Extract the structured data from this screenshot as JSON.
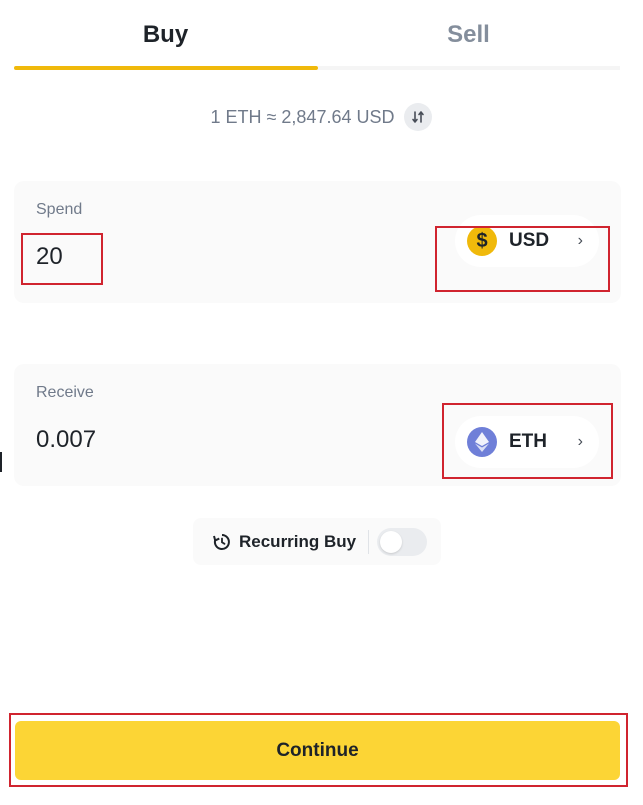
{
  "tabs": {
    "buy": "Buy",
    "sell": "Sell",
    "active": "Buy"
  },
  "rate": {
    "text": "1 ETH ≈ 2,847.64 USD"
  },
  "spend": {
    "label": "Spend",
    "amount": "20",
    "asset": "USD",
    "asset_icon": "dollar-coin-icon"
  },
  "receive": {
    "label": "Receive",
    "amount": "0.007",
    "asset": "ETH",
    "asset_icon": "ethereum-icon"
  },
  "recurring": {
    "label": "Recurring Buy",
    "enabled": false
  },
  "continue_label": "Continue",
  "colors": {
    "accent": "#f0b90b",
    "button": "#fcd535",
    "eth": "#6f7fd8",
    "annotation": "#d0242f"
  }
}
